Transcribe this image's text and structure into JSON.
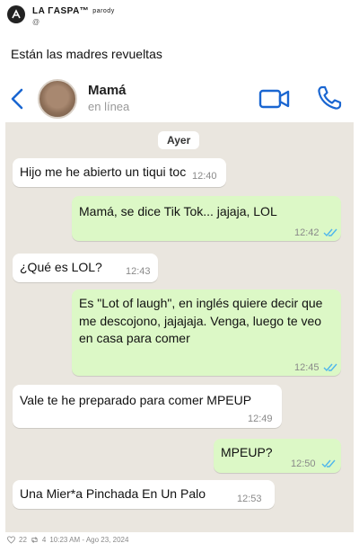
{
  "post": {
    "brand": "LA ΓASPA™",
    "brand_tag": "parody",
    "handle": "@",
    "caption": "Están las madres revueltas"
  },
  "chat": {
    "contact_name": "Mamá",
    "contact_status": "en línea",
    "day_label": "Ayer",
    "messages": [
      {
        "dir": "in",
        "text": "Hijo me he abierto un tiqui toc",
        "time": "12:40"
      },
      {
        "dir": "out",
        "text": "Mamá, se dice Tik Tok... jajaja, LOL",
        "time": "12:42",
        "read": true
      },
      {
        "dir": "in",
        "text": "¿Qué es LOL?",
        "time": "12:43"
      },
      {
        "dir": "out",
        "text": "Es \"Lot of laugh\", en inglés quiere decir que me descojono, jajajaja. Venga, luego te veo en casa para comer",
        "time": "12:45",
        "read": true
      },
      {
        "dir": "in",
        "text": "Vale te he preparado para comer MPEUP",
        "time": "12:49"
      },
      {
        "dir": "out",
        "text": "MPEUP?",
        "time": "12:50",
        "read": true
      },
      {
        "dir": "in",
        "text": "Una Mier*a Pinchada En Un Palo",
        "time": "12:53"
      }
    ]
  },
  "footer": {
    "likes": "22",
    "retweets": "4",
    "date": "10:23 AM - Ago 23, 2024"
  },
  "colors": {
    "chat_bg": "#eae6df",
    "bubble_out": "#dcf8c6",
    "bubble_in": "#ffffff",
    "accent": "#1a66d1",
    "read_ticks": "#4fb6ec"
  },
  "icons": [
    "rasp-logo-icon",
    "back-arrow-icon",
    "video-call-icon",
    "phone-call-icon",
    "double-check-icon",
    "heart-icon",
    "retweet-icon"
  ]
}
